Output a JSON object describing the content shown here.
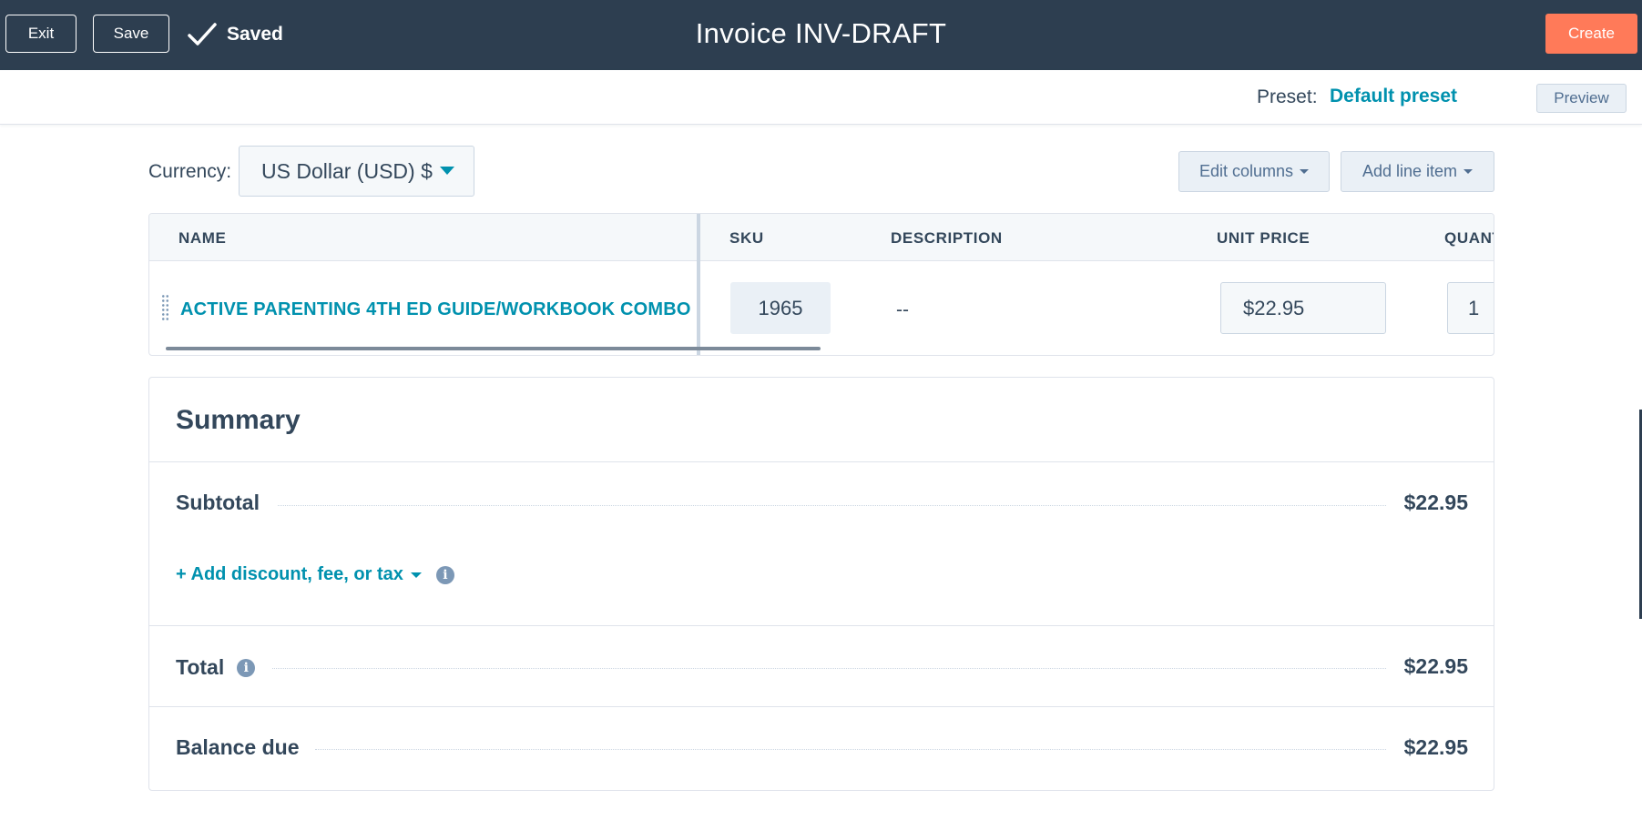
{
  "topbar": {
    "exit_label": "Exit",
    "save_label": "Save",
    "saved_status": "Saved",
    "title": "Invoice INV-DRAFT",
    "create_label": "Create",
    "background_color": "#2d3e50",
    "create_color": "#ff7a59"
  },
  "preset": {
    "label": "Preset:",
    "value": "Default preset",
    "preview_label": "Preview"
  },
  "currency": {
    "label": "Currency:",
    "selected": "US Dollar (USD) $"
  },
  "toolbar": {
    "edit_columns_label": "Edit columns",
    "add_line_item_label": "Add line item"
  },
  "table": {
    "columns": [
      "NAME",
      "SKU",
      "DESCRIPTION",
      "UNIT PRICE",
      "QUANT"
    ],
    "rows": [
      {
        "name": "ACTIVE PARENTING 4TH ED GUIDE/WORKBOOK COMBO",
        "sku": "1965",
        "description": "--",
        "unit_price": "$22.95",
        "quantity": "1"
      }
    ]
  },
  "summary": {
    "title": "Summary",
    "subtotal_label": "Subtotal",
    "subtotal_value": "$22.95",
    "add_adjustment_label": "+ Add discount, fee, or tax",
    "total_label": "Total",
    "total_value": "$22.95",
    "balance_label": "Balance due",
    "balance_value": "$22.95",
    "info_icon": "i"
  },
  "theme": {
    "accent": "#0091ae",
    "text": "#33475b"
  }
}
